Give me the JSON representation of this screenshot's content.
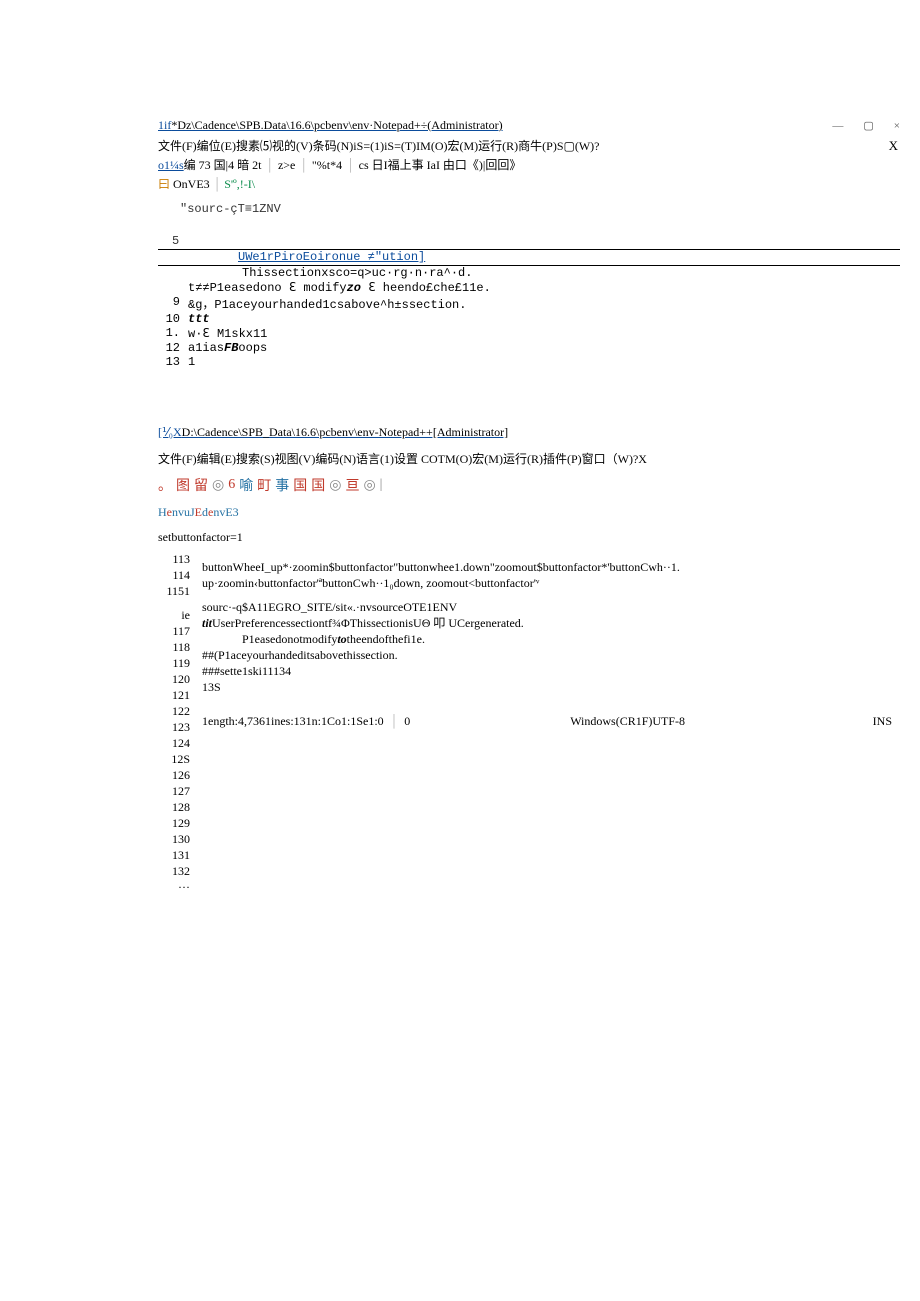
{
  "window1": {
    "title_link": "1if",
    "title_rest": "*Dz\\Cadence\\SPB.Data\\16.6\\pcbenv\\env·Notepad+÷(Administrator)",
    "win_min": "—",
    "win_max": "▢",
    "win_close": "×",
    "menu": "文件(F)编位(E)搜素⑸视的(V)条码(N)iS=(1)iS=(T)IM(O)宏(M)运行(R)商牛(P)S▢(W)?",
    "menu_x": "X",
    "toolbar_a": "o1¼s",
    "toolbar_b": "编 73 国|4 暗 2t",
    "toolbar_c": "z>e",
    "toolbar_d": "\"%t*4",
    "toolbar_e": "cs 日I福上事 IaI 由口《)|回回》",
    "tab_box": "曰",
    "tab_t1": "OnVE3",
    "tab_t2": "S'º,!-I\\",
    "code_top": "\"sourc-çT≡1ZNV",
    "gut5": "5",
    "section": "UWe1rPiroEoironue ≠\"ution]",
    "line_pre7": "Thissectionxsco=q>uc·rg·n·ra^·d.",
    "lines": [
      {
        "n": "",
        "t": "t≠≠P1easedono ℇ modifyzo ℇ heendo£che£11e."
      },
      {
        "n": "9",
        "t": "&g，P1aceyourhanded1csabove^h±ssection."
      },
      {
        "n": "10",
        "t": "ttt",
        "k": true
      },
      {
        "n": "1.",
        "t": "w·ℇ M1skx11"
      },
      {
        "n": "12",
        "t": "a1iasFBoops",
        "fb": true
      },
      {
        "n": "13",
        "t": "1",
        "blue": true
      }
    ]
  },
  "window2": {
    "title_pre": "[⅟₀X",
    "title": "D:\\Cadence\\SPB_Data\\16.6\\pcbenv\\env-Notepad++[Administrator]",
    "menu": "文件(F)编辑(E)搜索(S)视图(V)编码(N)语言(1)设置 COTM(O)宏(M)运行(R)插件(P)窗口（W)?X",
    "toolbar_icons": [
      "。",
      "图",
      "留",
      "◎",
      "6",
      "喻",
      "町",
      "事",
      "国",
      "国",
      "◎",
      "亘",
      "◎",
      "|"
    ],
    "tabs": "HenvuJEdenvE3",
    "first": "setbuttonfactor=1",
    "gutter": [
      "113",
      "114",
      "1151",
      "ie",
      "117",
      "118",
      "119",
      "120",
      "121",
      "122",
      "123",
      "124",
      "12S",
      "126",
      "127",
      "128",
      "129",
      "130",
      "131",
      "132",
      "···"
    ],
    "rows": {
      "r0": "buttonWheeI_up*·zoomin$buttonfactor\"buttonwhee1.down\"zoomout$buttonfactor*'buttonCwh··1.",
      "r1": "up·zoomin‹buttonfactor'ªbuttonCwh··1₀down, zoomout<buttonfactor'ᵛ",
      "r2": "sourc·-q$A11EGRO_SITE/sit«.·nvsourceOTE1ENV",
      "r3a": "tit",
      "r3b": "UserPreferencessectiontf¾ΦThissectionisUΘ 叩 UCergenerated.",
      "r4a": "P1easedonotmodify",
      "r4k": "to",
      "r4b": "theendofthefi1e.",
      "r5": "##(P1aceyourhandeditsabovethissection.",
      "r6": "###sette1ski11134",
      "r7": "13S"
    },
    "status": {
      "s1": "1ength:4,7361ines:131n:1Co1:1Se1:0",
      "s1b": "0",
      "s2": "Windows(CR1F)UTF-8",
      "s3": "INS"
    }
  }
}
